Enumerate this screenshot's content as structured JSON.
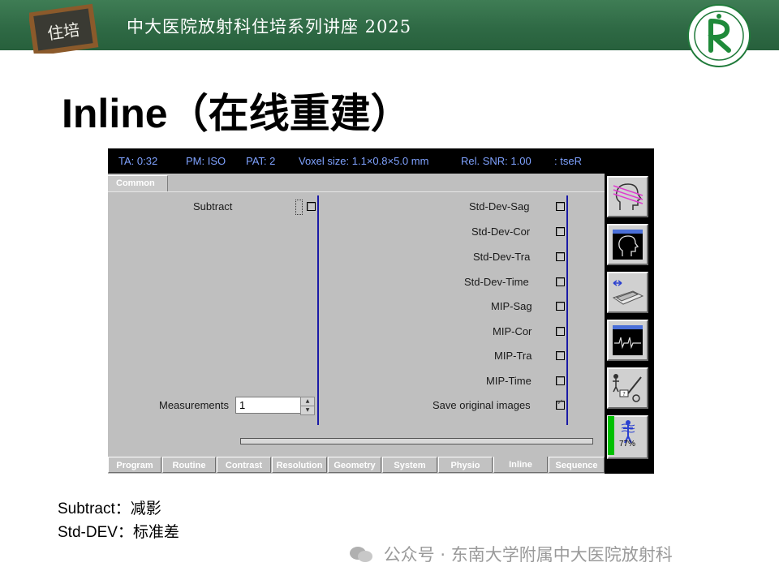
{
  "banner": {
    "logo_text": "住培",
    "title": "中大医院放射科住培系列讲座 2025",
    "hospital_logo_text": "东南大学附属中大医院放射科"
  },
  "slide_title": "Inline（在线重建）",
  "mr_ui": {
    "status": {
      "ta": "TA: 0:32",
      "pm": "PM: ISO",
      "pat": "PAT: 2",
      "voxel": "Voxel size: 1.1×0.8×5.0 mm",
      "snr": "Rel. SNR: 1.00",
      "seq": ": tseR"
    },
    "common_tab": "Common",
    "left": {
      "subtract_label": "Subtract",
      "subtract_checked": false,
      "measurements_label": "Measurements",
      "measurements_value": "1"
    },
    "right_options": [
      {
        "label": "Std-Dev-Sag",
        "checked": false
      },
      {
        "label": "Std-Dev-Cor",
        "checked": false
      },
      {
        "label": "Std-Dev-Tra",
        "checked": false
      },
      {
        "label": "Std-Dev-Time",
        "checked": false
      },
      {
        "label": "MIP-Sag",
        "checked": false
      },
      {
        "label": "MIP-Cor",
        "checked": false
      },
      {
        "label": "MIP-Tra",
        "checked": false
      },
      {
        "label": "MIP-Time",
        "checked": false
      },
      {
        "label": "Save original images",
        "checked": true
      }
    ],
    "bottom_tabs": [
      "Program",
      "Routine",
      "Contrast",
      "Resolution",
      "Geometry",
      "System",
      "Physio",
      "Inline",
      "Sequence"
    ],
    "active_tab": "Inline",
    "side_buttons": [
      "head-localizer-icon",
      "head-view-icon",
      "patient-table-icon",
      "ecg-monitor-icon",
      "patient-settings-icon",
      "sar-gauge-icon"
    ],
    "gauge_text": "77%",
    "gauge_level_percent": 77
  },
  "notes": {
    "line1": "Subtract：减影",
    "line2": "Std-DEV：标准差"
  },
  "watermark": "公众号 · 东南大学附属中大医院放射科"
}
